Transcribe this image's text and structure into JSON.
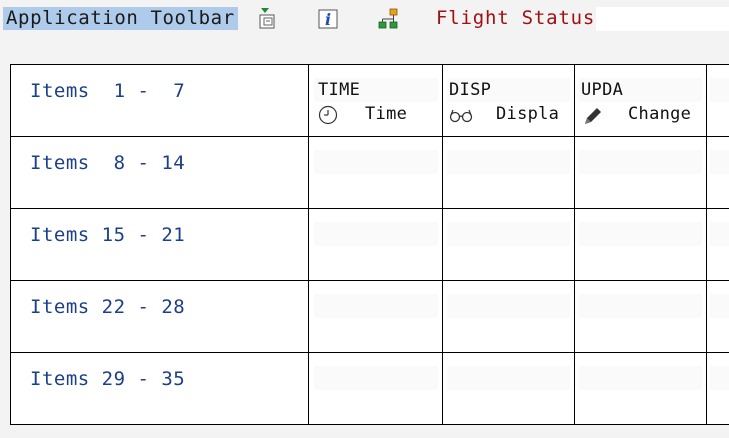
{
  "toolbar": {
    "title": "Application Toolbar",
    "icons": [
      "doc-export-icon",
      "info-icon",
      "hierarchy-icon"
    ],
    "status_label": "Flight Status"
  },
  "columns": [
    {
      "id": "TIME",
      "key": "TIME",
      "text": "Time",
      "icon": "clock-icon"
    },
    {
      "id": "DISP",
      "key": "DISP",
      "text": "Displa",
      "icon": "glasses-icon"
    },
    {
      "id": "UPDA",
      "key": "UPDA",
      "text": "Change",
      "icon": "pencil-icon"
    }
  ],
  "rows": [
    {
      "label": "Items  1 -  7"
    },
    {
      "label": "Items  8 - 14"
    },
    {
      "label": "Items 15 - 21"
    },
    {
      "label": "Items 22 - 28"
    },
    {
      "label": "Items 29 - 35"
    }
  ],
  "colors": {
    "selection": "#aecbec",
    "status_text": "#a01010",
    "row_label": "#1c3f8a"
  }
}
